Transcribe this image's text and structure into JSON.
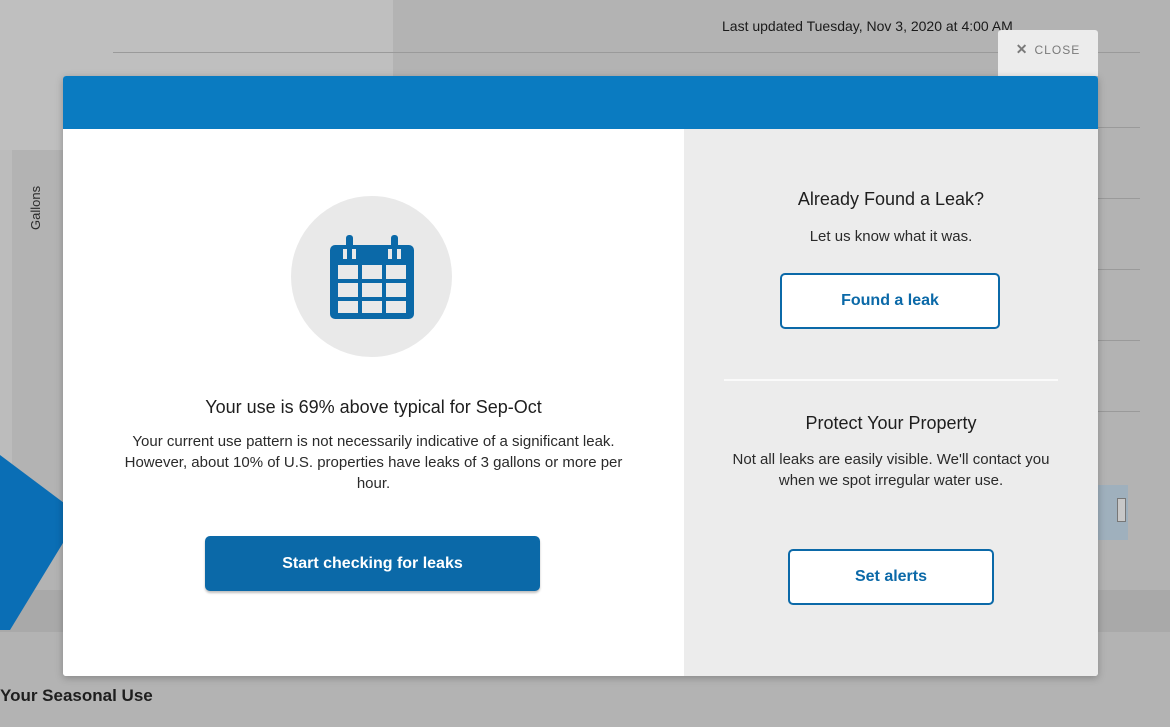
{
  "background": {
    "last_updated": "Last updated Tuesday, Nov 3, 2020 at 4:00 AM",
    "axis_label": "Gallons",
    "section_title": "Your Seasonal Use"
  },
  "close": {
    "label": "CLOSE",
    "icon": "close-icon"
  },
  "modal": {
    "header_color": "#0a7bc1",
    "icon": "calendar-icon",
    "heading": "Your use is 69% above typical for Sep-Oct",
    "body": "Your current use pattern is not necessarily indicative of a significant leak. However, about 10% of U.S. properties have leaks of 3 gallons or more per hour.",
    "primary_button": "Start checking for leaks",
    "found_leak": {
      "title": "Already Found a Leak?",
      "text": "Let us know what it was.",
      "button": "Found a leak"
    },
    "protect": {
      "title": "Protect Your Property",
      "text": "Not all leaks are easily visible. We'll contact you when we spot irregular water use.",
      "button": "Set alerts"
    }
  }
}
